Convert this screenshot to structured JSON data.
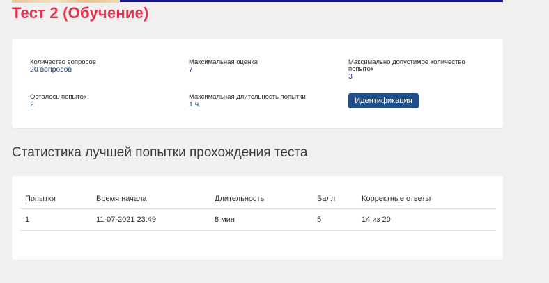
{
  "page": {
    "title": "Тест 2 (Обучение)"
  },
  "info": {
    "questions_count_label": "Количество вопросов",
    "questions_count_value": "20 вопросов",
    "max_score_label": "Максимальная оценка",
    "max_score_value": "7",
    "max_attempts_label": "Максимально допустимое количество попыток",
    "max_attempts_value": "3",
    "attempts_left_label": "Осталось попыток",
    "attempts_left_value": "2",
    "max_duration_label": "Максимальная длительность попытки",
    "max_duration_value": "1 ч.",
    "identification_button": "Идентификация"
  },
  "stats": {
    "title": "Статистика лучшей попытки прохождения теста",
    "columns": [
      "Попытки",
      "Время начала",
      "Длительность",
      "Балл",
      "Корректные ответы"
    ],
    "rows": [
      [
        "1",
        "11-07-2021 23:49",
        "8 мин",
        "5",
        "14 из 20"
      ]
    ]
  },
  "colors": {
    "title": "#e3314f",
    "accent_button": "#1f4f86",
    "top_bar": "#1d1a84"
  }
}
